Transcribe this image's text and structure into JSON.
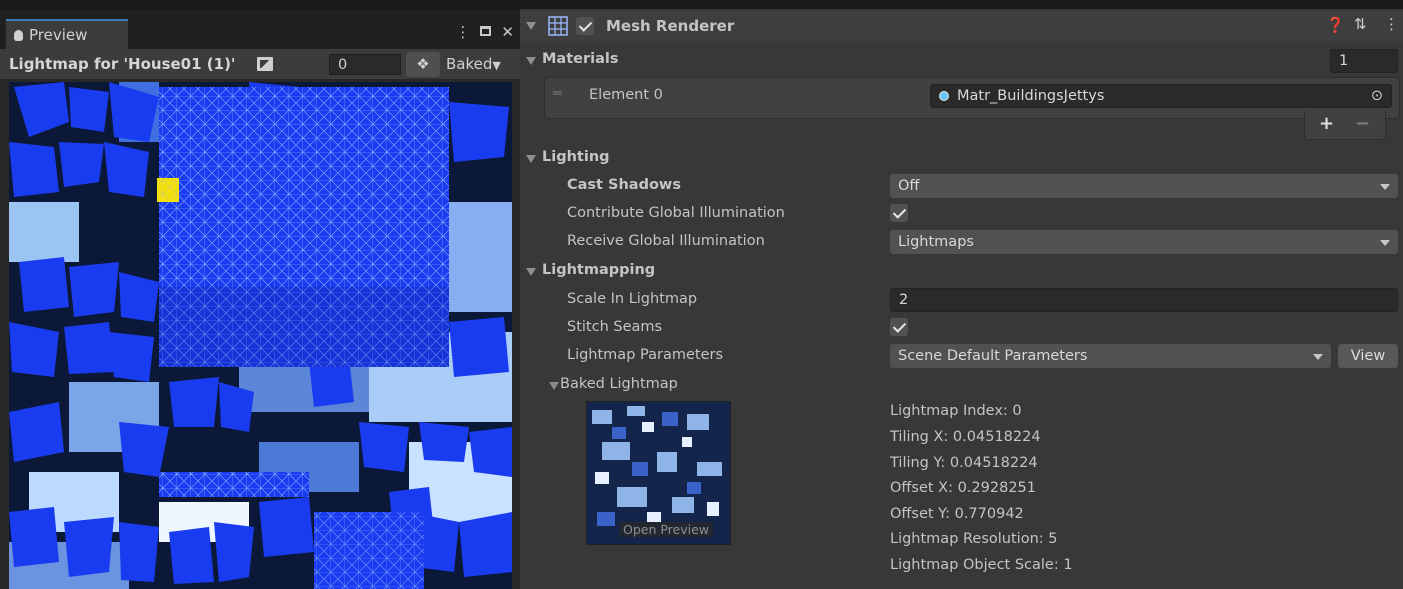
{
  "preview": {
    "tab_label": "Preview",
    "menu_icon": "kebab-menu-icon",
    "maximize_icon": "maximize-icon",
    "close_icon": "close-icon",
    "title": "Lightmap for 'House01 (1)'",
    "index_value": "0",
    "mode_label": "Baked"
  },
  "inspector": {
    "component_title": "Mesh Renderer",
    "component_enabled": true,
    "materials": {
      "header": "Materials",
      "count": "1",
      "element_label": "Element 0",
      "element_value": "Matr_BuildingsJettys",
      "add_label": "+",
      "remove_label": "−"
    },
    "lighting": {
      "header": "Lighting",
      "cast_shadows_label": "Cast Shadows",
      "cast_shadows_value": "Off",
      "contribute_gi_label": "Contribute Global Illumination",
      "contribute_gi_checked": true,
      "receive_gi_label": "Receive Global Illumination",
      "receive_gi_value": "Lightmaps"
    },
    "lightmapping": {
      "header": "Lightmapping",
      "scale_label": "Scale In Lightmap",
      "scale_value": "2",
      "stitch_label": "Stitch Seams",
      "stitch_checked": true,
      "params_label": "Lightmap Parameters",
      "params_value": "Scene Default Parameters",
      "view_label": "View",
      "baked_header": "Baked Lightmap",
      "open_preview_label": "Open Preview",
      "info": [
        "Lightmap Index: 0",
        "Tiling X: 0.04518224",
        "Tiling Y: 0.04518224",
        "Offset X: 0.2928251",
        "Offset Y: 0.770942",
        "Lightmap Resolution: 5",
        "Lightmap Object Scale: 1"
      ]
    }
  },
  "colors": {
    "accent": "#3a79bb",
    "lightmap_blue": "#1a3cf0",
    "highlight_yellow": "#f5e10a"
  }
}
